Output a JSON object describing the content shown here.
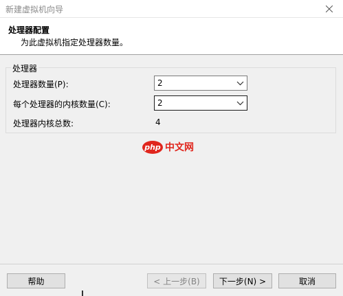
{
  "window": {
    "title": "新建虚拟机向导"
  },
  "header": {
    "title": "处理器配置",
    "subtitle": "为此虚拟机指定处理器数量。"
  },
  "group": {
    "label": "处理器",
    "processor_count": {
      "label": "处理器数量(P):",
      "value": "2"
    },
    "cores_per_processor": {
      "label": "每个处理器的内核数量(C):",
      "value": "2"
    },
    "total_cores": {
      "label": "处理器内核总数:",
      "value": "4"
    }
  },
  "watermark": {
    "logo_badge": "php",
    "logo_text": "中文网"
  },
  "buttons": {
    "help": "帮助",
    "back": "< 上一步(B)",
    "next": "下一步(N) >",
    "cancel": "取消"
  },
  "icons": {
    "close": "close-icon",
    "dropdown": "chevron-down-icon"
  }
}
